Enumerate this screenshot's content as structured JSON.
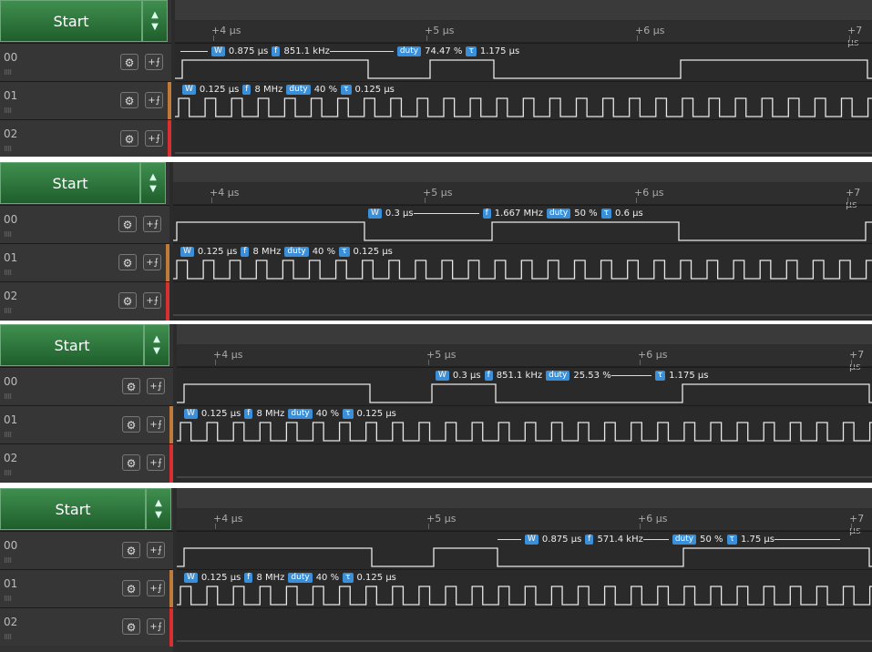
{
  "app": {
    "start_label": "Start",
    "up_arrow": "▲",
    "down_arrow": "▼",
    "gear_glyph": "⚙",
    "trigger_glyph": "+⨍"
  },
  "ruler": {
    "ticks": [
      "+4 µs",
      "+5 µs",
      "+6 µs",
      "+7 µs"
    ]
  },
  "channels": [
    {
      "label": "00",
      "color": "#ffffff"
    },
    {
      "label": "01",
      "color": "#c07a3a"
    },
    {
      "label": "02",
      "color": "#d83030"
    }
  ],
  "colors": {
    "accent": "#3a8fd8",
    "channel01": "#c07a3a",
    "channel02": "#d83030",
    "start_green": "#2f7a3d"
  },
  "panels": [
    {
      "ch00": {
        "w": "0.875 µs",
        "f": "851.1 kHz",
        "duty": "74.47 %",
        "tau": "1.175 µs"
      },
      "ch01": {
        "w": "0.125 µs",
        "f": "8 MHz",
        "duty": "40 %",
        "tau": "0.125 µs"
      }
    },
    {
      "ch00": {
        "w": "0.3 µs",
        "f": "1.667 MHz",
        "duty": "50 %",
        "tau": "0.6 µs"
      },
      "ch01": {
        "w": "0.125 µs",
        "f": "8 MHz",
        "duty": "40 %",
        "tau": "0.125 µs"
      }
    },
    {
      "ch00": {
        "w": "0.3 µs",
        "f": "851.1 kHz",
        "duty": "25.53 %",
        "tau": "1.175 µs"
      },
      "ch01": {
        "w": "0.125 µs",
        "f": "8 MHz",
        "duty": "40 %",
        "tau": "0.125 µs"
      }
    },
    {
      "ch00": {
        "w": "0.875 µs",
        "f": "571.4 kHz",
        "duty": "50 %",
        "tau": "1.75 µs"
      },
      "ch01": {
        "w": "0.125 µs",
        "f": "8 MHz",
        "duty": "40 %",
        "tau": "0.125 µs"
      }
    }
  ],
  "tags": {
    "w": "W",
    "f": "f",
    "duty": "duty",
    "tau": "τ"
  }
}
